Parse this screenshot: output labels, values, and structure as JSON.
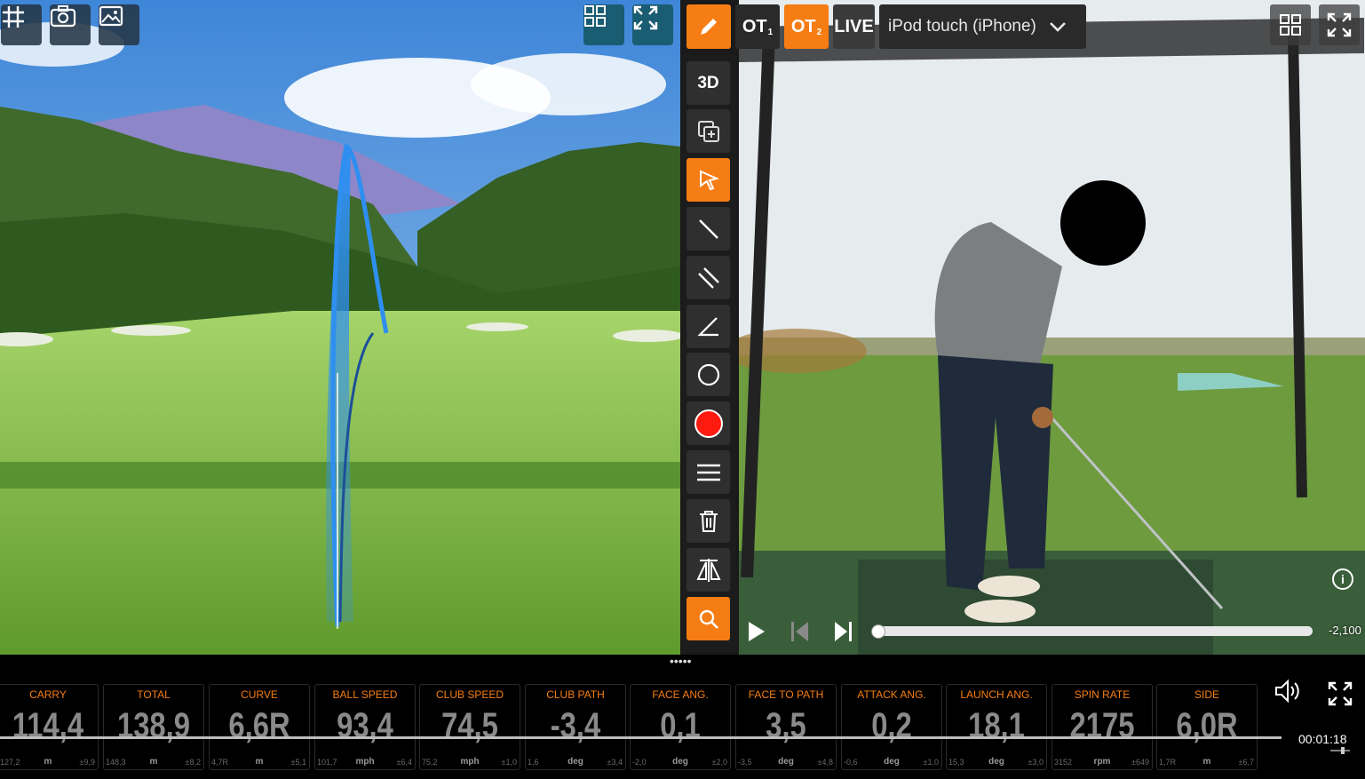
{
  "sim_toolbar": {
    "icons": [
      "grid-hash-icon",
      "camera-icon",
      "image-icon",
      "layout-grid-icon",
      "fullscreen-icon"
    ]
  },
  "video_toolbar": {
    "ot1_label": "OT",
    "ot1_sub": "1",
    "ot2_label": "OT",
    "ot2_sub": "2",
    "live_label": "LIVE",
    "device_select": "iPod touch (iPhone)"
  },
  "tools": {
    "three_d_label": "3D"
  },
  "player": {
    "frame_value": "-2,100",
    "timecode": "00:01:18"
  },
  "colors": {
    "accent": "#f57d13",
    "stat_label": "#f57d13",
    "rail": "#1c1c1c",
    "trace": "#2e8ff0"
  },
  "stats": [
    {
      "label": "CARRY",
      "value": "114,4",
      "min": "127,2",
      "unit": "m",
      "dev": "±9,9"
    },
    {
      "label": "TOTAL",
      "value": "138,9",
      "min": "148,3",
      "unit": "m",
      "dev": "±8,2"
    },
    {
      "label": "CURVE",
      "value": "6,6R",
      "min": "4,7R",
      "unit": "m",
      "dev": "±5,1"
    },
    {
      "label": "BALL SPEED",
      "value": "93,4",
      "min": "101,7",
      "unit": "mph",
      "dev": "±6,4"
    },
    {
      "label": "CLUB SPEED",
      "value": "74,5",
      "min": "75,2",
      "unit": "mph",
      "dev": "±1,0"
    },
    {
      "label": "CLUB PATH",
      "value": "-3,4",
      "min": "1,6",
      "unit": "deg",
      "dev": "±3,4"
    },
    {
      "label": "FACE ANG.",
      "value": "0,1",
      "min": "-2,0",
      "unit": "deg",
      "dev": "±2,0"
    },
    {
      "label": "FACE TO PATH",
      "value": "3,5",
      "min": "-3,5",
      "unit": "deg",
      "dev": "±4,8"
    },
    {
      "label": "ATTACK ANG.",
      "value": "0,2",
      "min": "-0,6",
      "unit": "deg",
      "dev": "±1,0"
    },
    {
      "label": "LAUNCH ANG.",
      "value": "18,1",
      "min": "15,3",
      "unit": "deg",
      "dev": "±3,0"
    },
    {
      "label": "SPIN RATE",
      "value": "2175",
      "min": "3152",
      "unit": "rpm",
      "dev": "±649"
    },
    {
      "label": "SIDE",
      "value": "6,0R",
      "min": "1,7R",
      "unit": "m",
      "dev": "±6,7"
    }
  ]
}
